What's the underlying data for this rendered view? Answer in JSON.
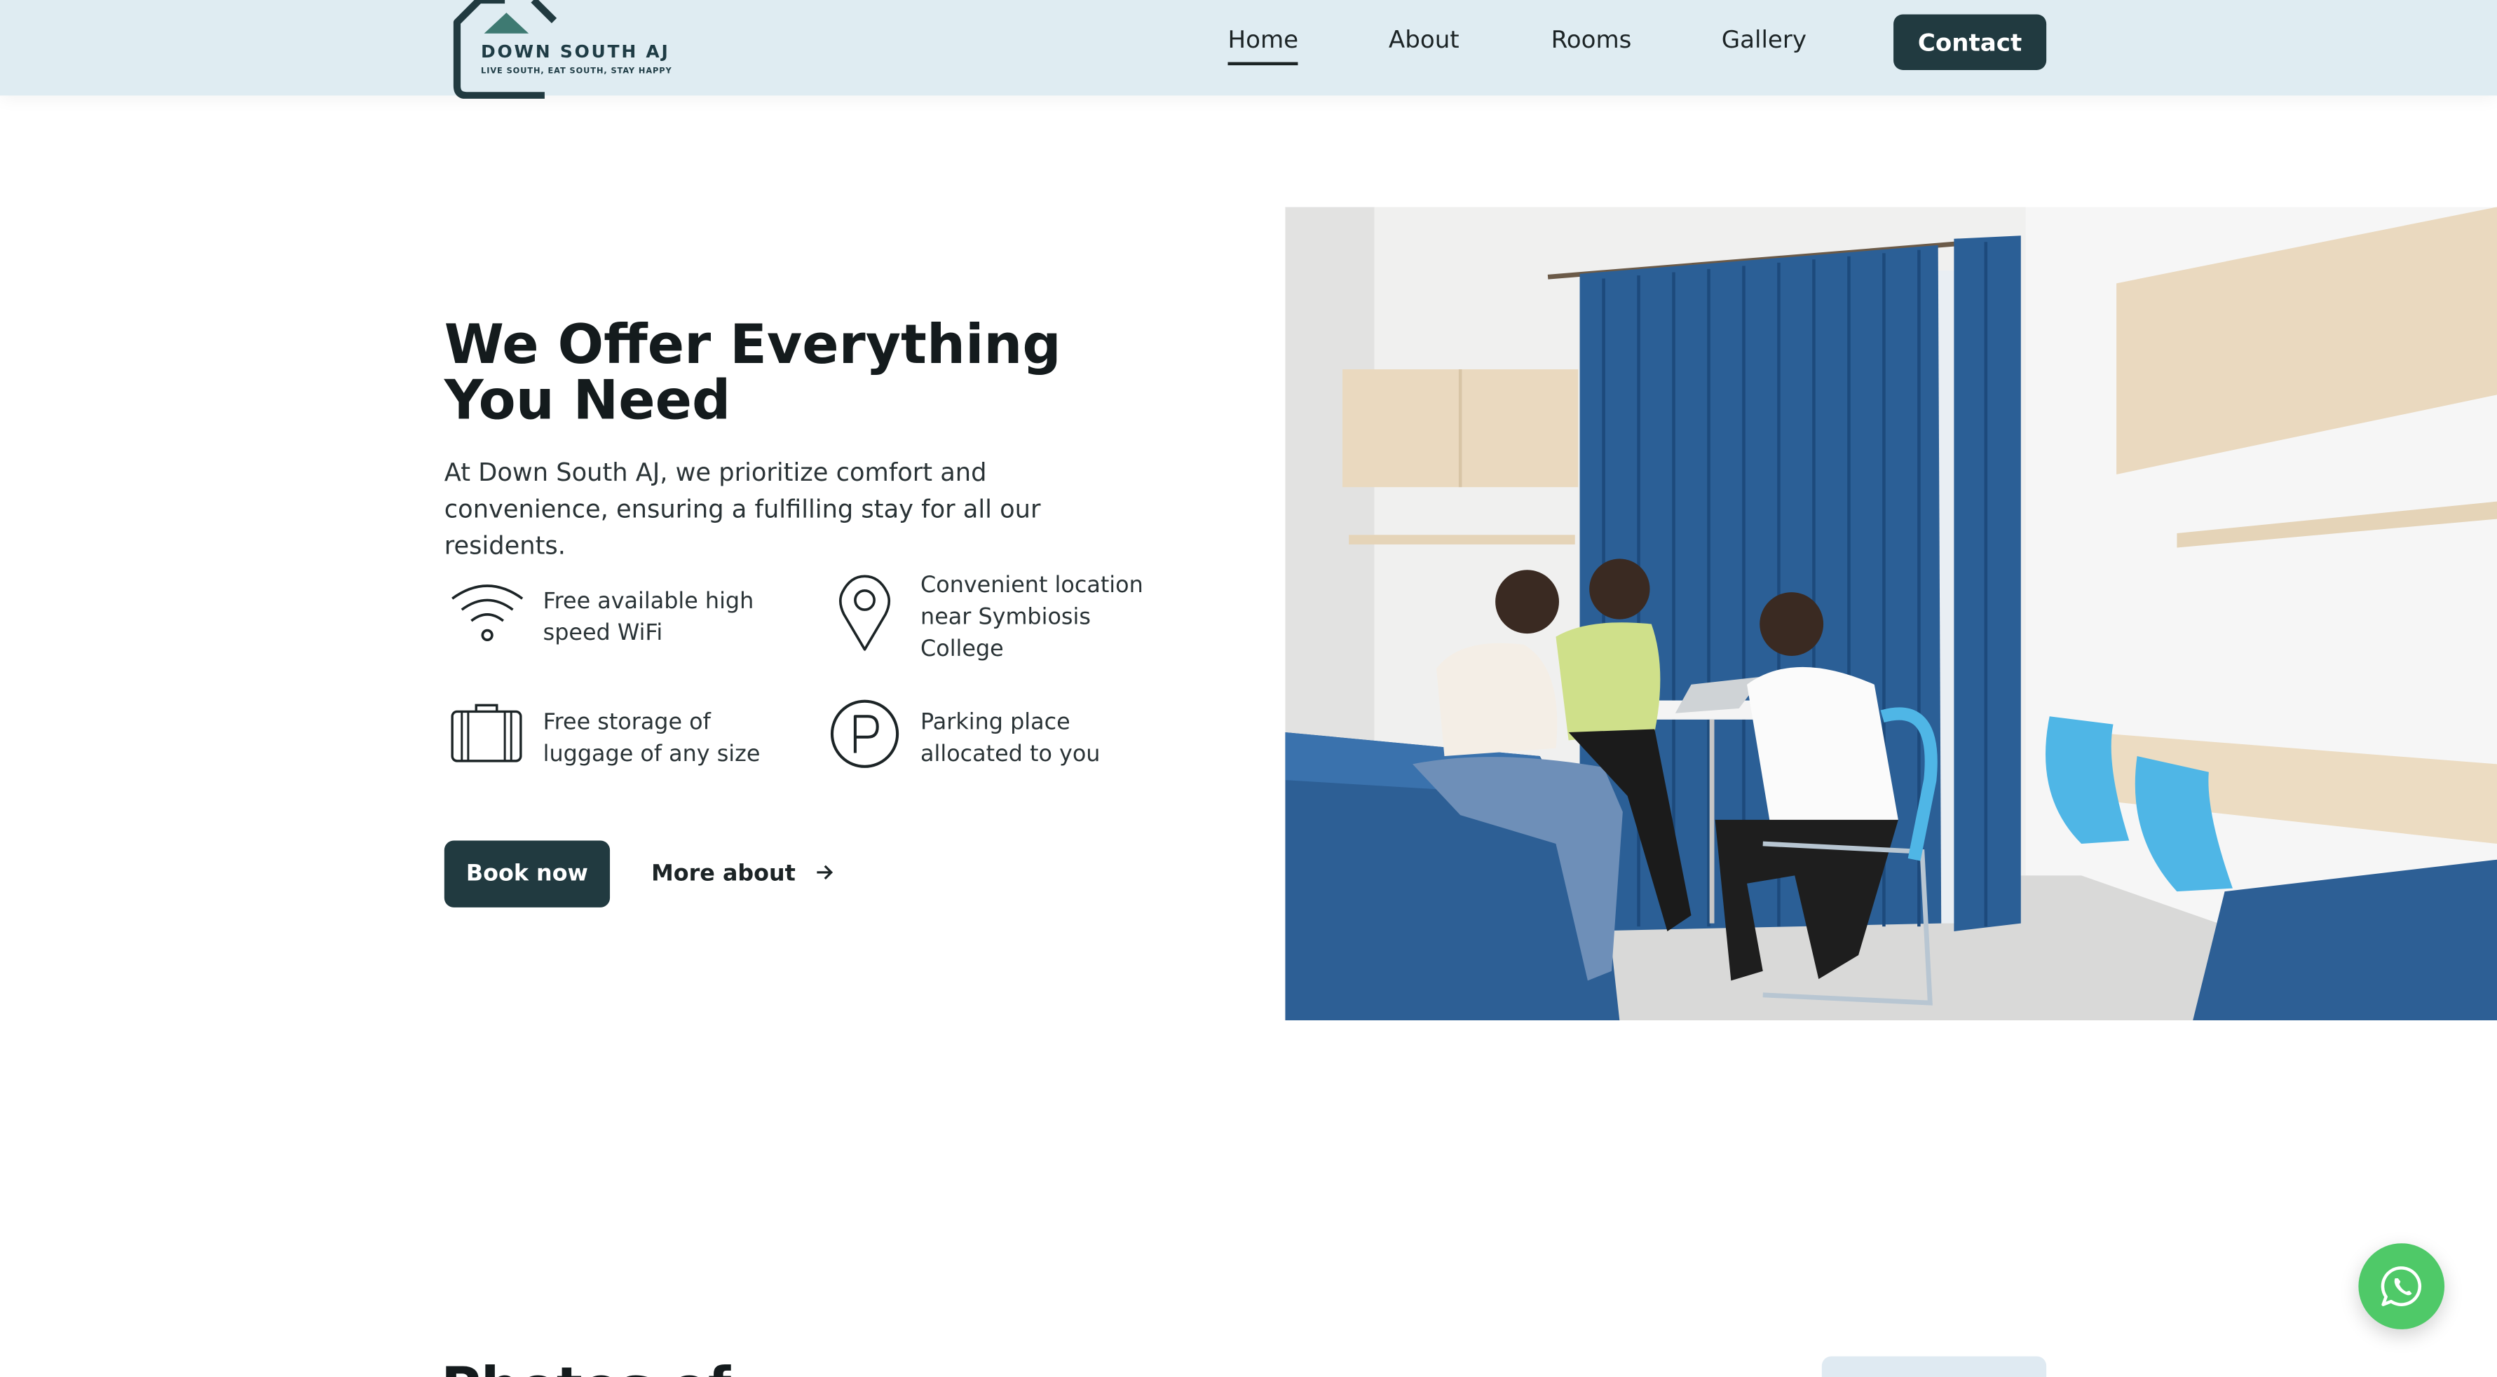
{
  "brand": {
    "name": "DOWN SOUTH AJ",
    "tagline": "LIVE SOUTH, EAT SOUTH, STAY HAPPY"
  },
  "nav": {
    "items": [
      {
        "label": "Home",
        "active": true
      },
      {
        "label": "About",
        "active": false
      },
      {
        "label": "Rooms",
        "active": false
      },
      {
        "label": "Gallery",
        "active": false
      }
    ],
    "contact_label": "Contact"
  },
  "hero": {
    "title": "We Offer Everything You Need",
    "description": "At Down South AJ, we prioritize comfort and convenience, ensuring a fulfilling stay for all our residents.",
    "features": [
      {
        "icon": "wifi-icon",
        "text": "Free available high speed WiFi"
      },
      {
        "icon": "location-pin-icon",
        "text": "Convenient location near Symbiosis College"
      },
      {
        "icon": "luggage-icon",
        "text": "Free storage of luggage of any size"
      },
      {
        "icon": "parking-icon",
        "text": "Parking place allocated to you"
      }
    ],
    "book_label": "Book now",
    "more_label": "More about"
  },
  "next_section": {
    "title_partial": "Photos of"
  },
  "colors": {
    "nav_bg": "#dfecf2",
    "primary_dark": "#213a40",
    "whatsapp_green": "#4fc968",
    "curtain_blue": "#2b5f96",
    "chair_cyan": "#4fb6e6"
  }
}
